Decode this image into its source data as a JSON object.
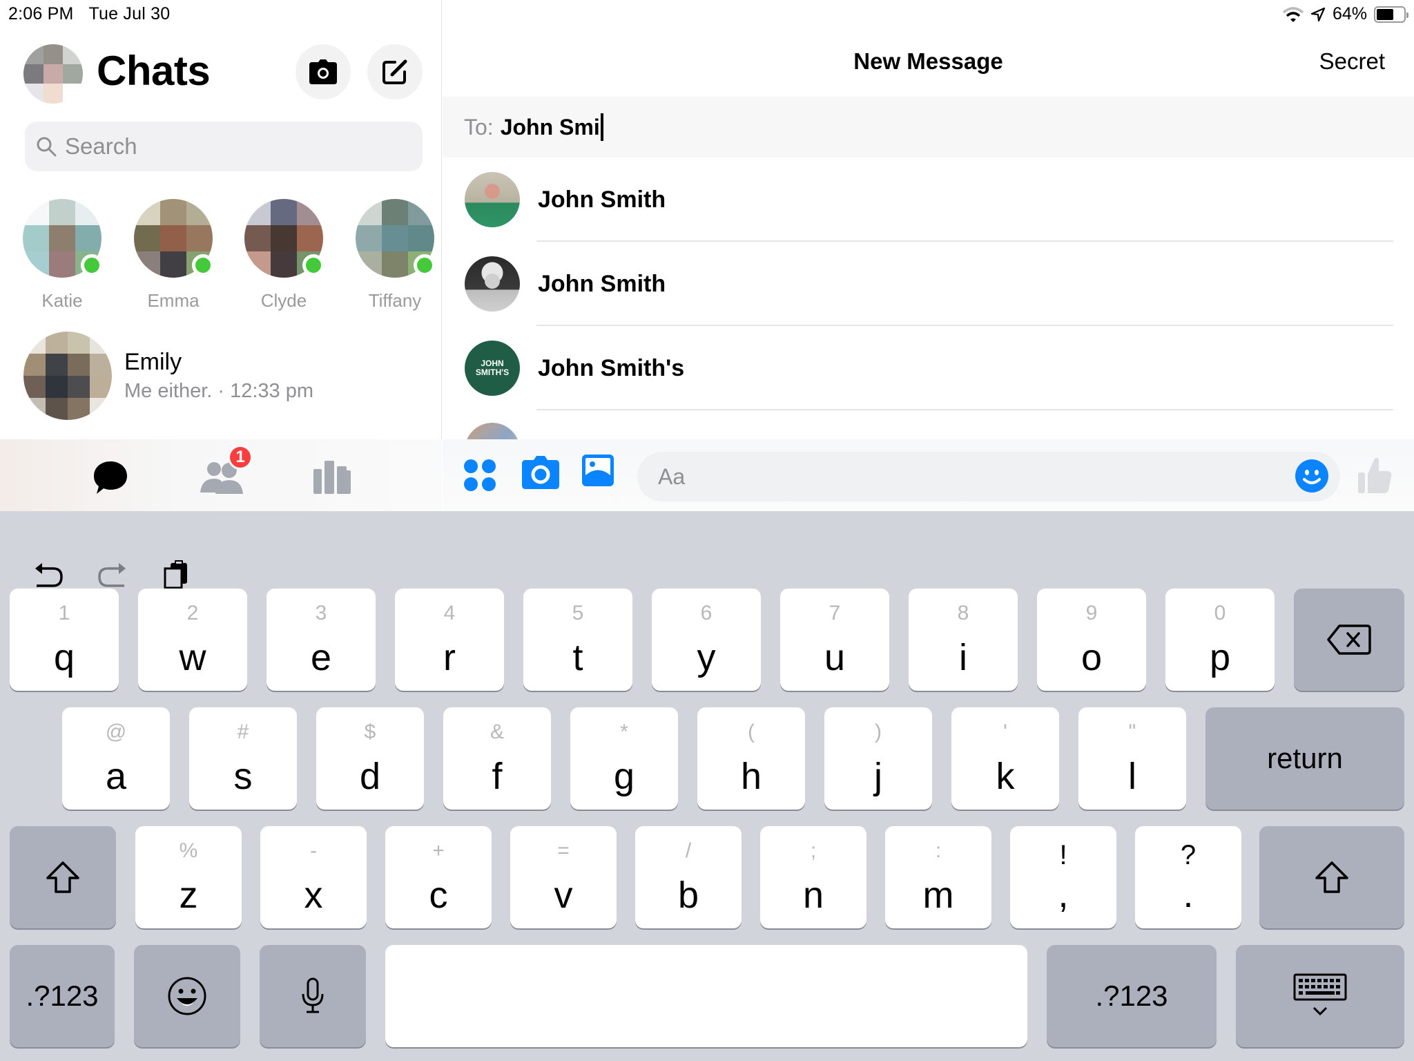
{
  "status_bar": {
    "time": "2:06 PM",
    "date": "Tue Jul 30",
    "battery_text": "64%",
    "battery_level": 0.64
  },
  "left_pane": {
    "title": "Chats",
    "search_placeholder": "Search",
    "stories": [
      {
        "name": "Katie",
        "online": true,
        "colors": [
          "#f5f7f8",
          "#c2d0cc",
          "#e6eef0",
          "#a3cbc9",
          "#8e7e6e",
          "#82adac",
          "#a6ced0",
          "#9c7b7c",
          "#89b389"
        ]
      },
      {
        "name": "Emma",
        "online": true,
        "colors": [
          "#d7d3bf",
          "#a29278",
          "#b4ad96",
          "#726b4f",
          "#925f4a",
          "#97775d",
          "#8b7f7b",
          "#413e44",
          "#86a26e"
        ]
      },
      {
        "name": "Clyde",
        "online": true,
        "colors": [
          "#c8c9d3",
          "#666a80",
          "#a28e92",
          "#745a50",
          "#473833",
          "#9b6550",
          "#c39a8c",
          "#473a3c",
          "#78946a"
        ]
      },
      {
        "name": "Tiffany",
        "online": true,
        "colors": [
          "#cfd6d2",
          "#6d8075",
          "#819a9c",
          "#8fa8a9",
          "#678f93",
          "#62898a",
          "#a9b09f",
          "#7d8469",
          "#8db077"
        ]
      }
    ],
    "conversations": [
      {
        "name": "Emily",
        "preview": "Me either. · 12:33 pm",
        "colors": [
          "#e9e5dc",
          "#bdb19b",
          "#c9c3ae",
          "#e7e4dd",
          "#a08f75",
          "#3f4246",
          "#7a6c5a",
          "#bcb09c",
          "#6f6055",
          "#2f343d",
          "#4d4c4f",
          "#bdae9a",
          "#c4bdb3",
          "#5d534a",
          "#857462",
          "#e9e6e2"
        ]
      }
    ],
    "tabs": [
      {
        "name": "chats",
        "active": true
      },
      {
        "name": "people",
        "badge": "1"
      },
      {
        "name": "discover"
      }
    ]
  },
  "right_pane": {
    "title": "New Message",
    "secret_label": "Secret",
    "to_label": "To:",
    "to_value": "John Smi",
    "results": [
      {
        "name": "John Smith"
      },
      {
        "name": "John Smith"
      },
      {
        "name": "John Smith's",
        "logo_text": "JOHN SMITH'S"
      }
    ],
    "composer_placeholder": "Aa"
  },
  "keyboard": {
    "row1": [
      {
        "alt": "1",
        "main": "q"
      },
      {
        "alt": "2",
        "main": "w"
      },
      {
        "alt": "3",
        "main": "e"
      },
      {
        "alt": "4",
        "main": "r"
      },
      {
        "alt": "5",
        "main": "t"
      },
      {
        "alt": "6",
        "main": "y"
      },
      {
        "alt": "7",
        "main": "u"
      },
      {
        "alt": "8",
        "main": "i"
      },
      {
        "alt": "9",
        "main": "o"
      },
      {
        "alt": "0",
        "main": "p"
      }
    ],
    "row2": [
      {
        "alt": "@",
        "main": "a"
      },
      {
        "alt": "#",
        "main": "s"
      },
      {
        "alt": "$",
        "main": "d"
      },
      {
        "alt": "&",
        "main": "f"
      },
      {
        "alt": "*",
        "main": "g"
      },
      {
        "alt": "(",
        "main": "h"
      },
      {
        "alt": ")",
        "main": "j"
      },
      {
        "alt": "'",
        "main": "k"
      },
      {
        "alt": "\"",
        "main": "l"
      }
    ],
    "row3": [
      {
        "alt": "%",
        "main": "z"
      },
      {
        "alt": "-",
        "main": "x"
      },
      {
        "alt": "+",
        "main": "c"
      },
      {
        "alt": "=",
        "main": "v"
      },
      {
        "alt": "/",
        "main": "b"
      },
      {
        "alt": ";",
        "main": "n"
      },
      {
        "alt": ":",
        "main": "m"
      },
      {
        "alt": "!",
        "main": ","
      },
      {
        "alt": "?",
        "main": "."
      }
    ],
    "return_label": "return",
    "numbers_label": ".?123"
  }
}
